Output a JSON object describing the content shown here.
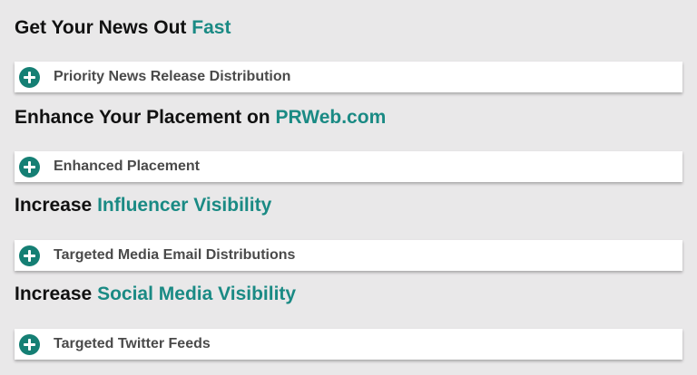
{
  "sections": [
    {
      "heading_prefix": "Get Your News Out",
      "heading_accent": "Fast",
      "item_label": "Priority News Release Distribution",
      "item_icon": "plus-circle-icon"
    },
    {
      "heading_prefix": "Enhance Your Placement on",
      "heading_accent": "PRWeb.com",
      "item_label": "Enhanced Placement",
      "item_icon": "plus-circle-icon"
    },
    {
      "heading_prefix": "Increase",
      "heading_accent": "Influencer Visibility",
      "item_label": "Targeted Media Email Distributions",
      "item_icon": "plus-circle-icon"
    },
    {
      "heading_prefix": "Increase",
      "heading_accent": "Social Media Visibility",
      "item_label": "Targeted Twitter Feeds",
      "item_icon": "plus-circle-icon"
    }
  ],
  "colors": {
    "accent": "#1a8a84",
    "icon": "#157f74",
    "background": "#e9e8e9",
    "heading": "#111111",
    "item_text": "#4a4a4a"
  }
}
